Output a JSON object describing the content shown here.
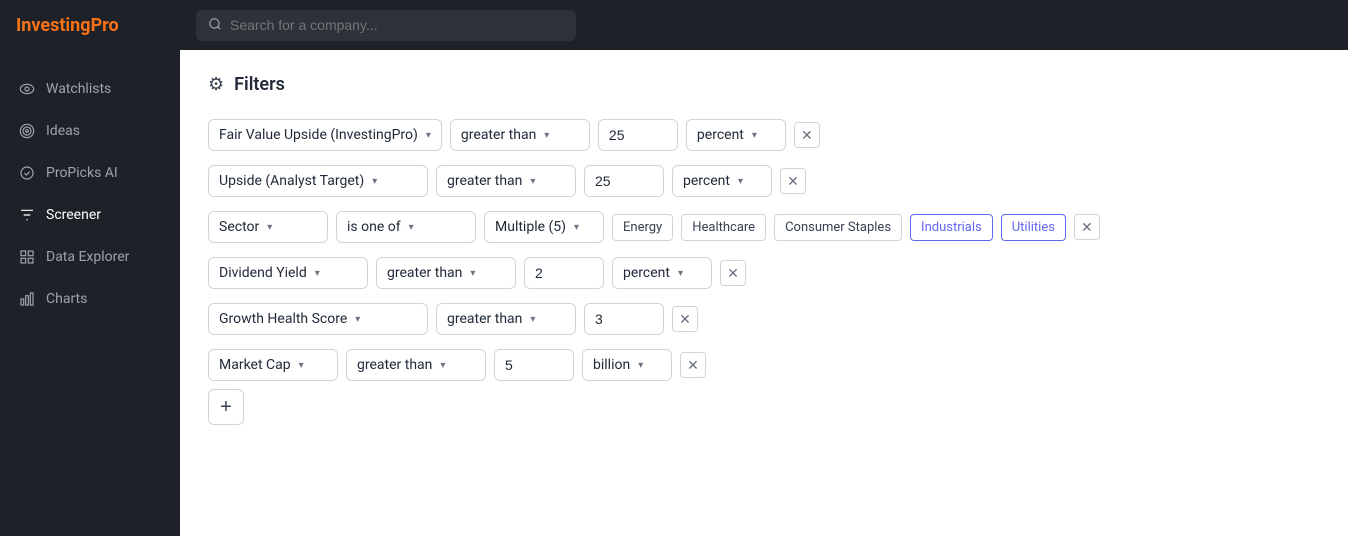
{
  "brand": {
    "name_part1": "Investing",
    "name_part2": "Pro"
  },
  "nav": {
    "items": [
      {
        "id": "watchlists",
        "label": "Watchlists",
        "icon": "eye"
      },
      {
        "id": "ideas",
        "label": "Ideas",
        "icon": "target"
      },
      {
        "id": "propicks",
        "label": "ProPicks AI",
        "icon": "circle"
      },
      {
        "id": "screener",
        "label": "Screener",
        "icon": "filter",
        "active": true
      },
      {
        "id": "data-explorer",
        "label": "Data Explorer",
        "icon": "grid"
      },
      {
        "id": "charts",
        "label": "Charts",
        "icon": "bar-chart"
      }
    ]
  },
  "topbar": {
    "search_placeholder": "Search for a company..."
  },
  "page": {
    "title": "Filters",
    "settings_icon": "⚙"
  },
  "filters": [
    {
      "id": "filter-1",
      "metric": "Fair Value Upside (InvestingPro)",
      "operator": "greater than",
      "value": "25",
      "unit": "percent",
      "type": "simple"
    },
    {
      "id": "filter-2",
      "metric": "Upside (Analyst Target)",
      "operator": "greater than",
      "value": "25",
      "unit": "percent",
      "type": "simple"
    },
    {
      "id": "filter-3",
      "metric": "Sector",
      "operator": "is one of",
      "multiple_label": "Multiple (5)",
      "tags": [
        "Energy",
        "Healthcare",
        "Consumer Staples",
        "Industrials",
        "Utilities"
      ],
      "highlighted_tags": [
        "Industrials",
        "Utilities"
      ],
      "type": "tags"
    },
    {
      "id": "filter-4",
      "metric": "Dividend Yield",
      "operator": "greater than",
      "value": "2",
      "unit": "percent",
      "type": "simple"
    },
    {
      "id": "filter-5",
      "metric": "Growth Health Score",
      "operator": "greater than",
      "value": "3",
      "type": "no-unit"
    },
    {
      "id": "filter-6",
      "metric": "Market Cap",
      "operator": "greater than",
      "value": "5",
      "unit": "billion",
      "type": "simple"
    }
  ],
  "add_button_label": "+"
}
